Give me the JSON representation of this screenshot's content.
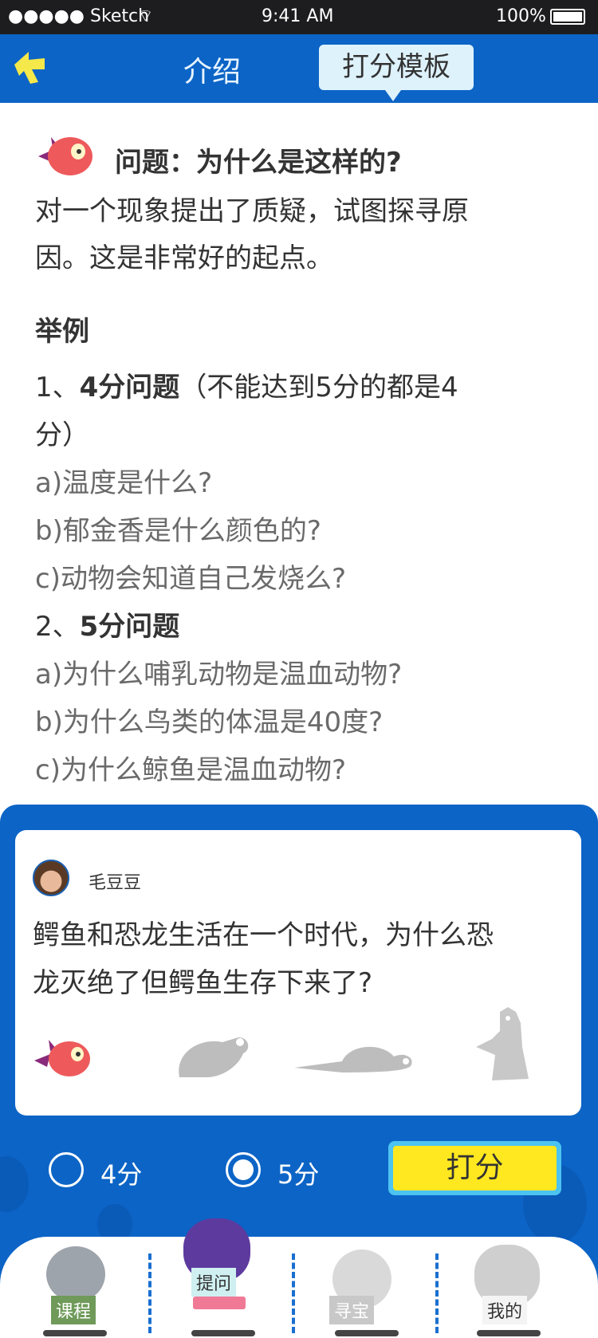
{
  "status_bar": {
    "carrier": "●●●●● Sketch",
    "time": "9:41 AM",
    "battery": "100%"
  },
  "nav": {
    "tabs": [
      {
        "label": "介绍",
        "active": false
      },
      {
        "label": "打分模板",
        "active": true
      }
    ]
  },
  "intro": {
    "title": "问题：为什么是这样的?",
    "description_lines": [
      "对一个现象提出了质疑，试图探寻原",
      "因。这是非常好的起点。"
    ],
    "examples_heading": "举例",
    "group1": {
      "prefix": "1、",
      "title": "4分问题",
      "note_line1": "（不能达到5分的都是4",
      "note_line2": "分）",
      "items": [
        "a)温度是什么?",
        "b)郁金香是什么颜色的?",
        "c)动物会知道自己发烧么?"
      ]
    },
    "group2": {
      "prefix": "2、",
      "title": "5分问题",
      "items": [
        "a)为什么哺乳动物是温血动物?",
        "b)为什么鸟类的体温是40度?",
        "c)为什么鲸鱼是温血动物?"
      ]
    }
  },
  "question_card": {
    "user": "毛豆豆",
    "question_lines": [
      "鳄鱼和恐龙生活在一个时代，为什么恐",
      "龙灭绝了但鳄鱼生存下来了?"
    ]
  },
  "scoring": {
    "options": [
      {
        "label": "4分",
        "selected": false
      },
      {
        "label": "5分",
        "selected": true
      }
    ],
    "submit_label": "打分"
  },
  "tab_bar": {
    "items": [
      {
        "label": "课程"
      },
      {
        "label": "提问"
      },
      {
        "label": "寻宝"
      },
      {
        "label": "我的"
      }
    ]
  },
  "colors": {
    "brand_blue": "#0c64c6",
    "button_yellow": "#ffe81f",
    "active_tab_bg": "#def2fc"
  }
}
